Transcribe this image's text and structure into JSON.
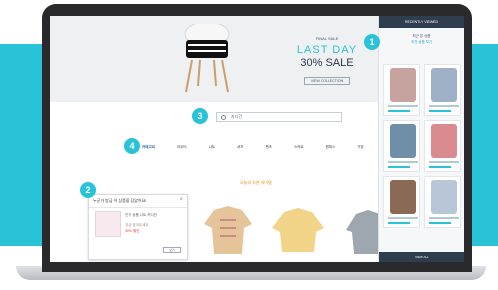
{
  "hero": {
    "promo_small": "FINAL SALE",
    "promo_big": "LAST DAY",
    "promo_sale": "30% SALE",
    "promo_button": "VIEW COLLECTION"
  },
  "markers": {
    "m1": "1",
    "m2": "2",
    "m3": "3",
    "m4": "4"
  },
  "search": {
    "value": "카디건"
  },
  "categories": [
    "카테고리",
    "아우터",
    "니트",
    "셔츠",
    "팬츠",
    "스커트",
    "원피스",
    "가방"
  ],
  "section_title": "오늘의 추천 아이템",
  "popup": {
    "header": "누군가 방금 이 상품을 담았어요!",
    "line1": "인기 상품 니트 카디건",
    "line2": "지금 담아두세요",
    "price": "30% 할인",
    "button": "보기"
  },
  "panel": {
    "header": "RECENTLY VIEWED",
    "title": "최근 본 상품",
    "subtitle": "추천 상품 보기",
    "footer": "VIEW ALL",
    "items": [
      {
        "color": "#c7a3a0"
      },
      {
        "color": "#9fb1c6"
      },
      {
        "color": "#6f8fa8"
      },
      {
        "color": "#d98b8f"
      },
      {
        "color": "#8a6a55"
      },
      {
        "color": "#b8c6d8"
      }
    ]
  },
  "products": [
    {
      "color": "#e6c49a"
    },
    {
      "color": "#f2d488"
    },
    {
      "color": "#9ea6b0"
    }
  ]
}
